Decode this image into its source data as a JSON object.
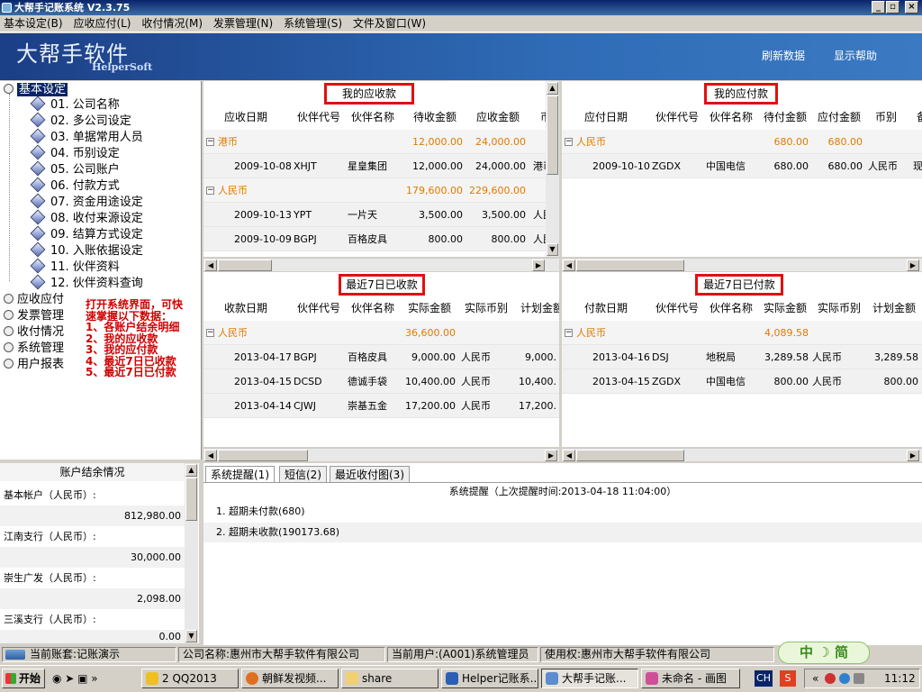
{
  "window": {
    "title": "大帮手记账系统 V2.3.75",
    "buttons": [
      "_",
      "▫",
      "×"
    ]
  },
  "menu": [
    "基本设定(B)",
    "应收应付(L)",
    "收付情况(M)",
    "发票管理(N)",
    "系统管理(S)",
    "文件及窗口(W)"
  ],
  "banner": {
    "logo_cn": "大帮手软件",
    "logo_en": "HelperSoft",
    "refresh": "刷新数据",
    "help": "显示帮助"
  },
  "tree": {
    "root": "基本设定",
    "items": [
      "01. 公司名称",
      "02. 多公司设定",
      "03. 单据常用人员",
      "04. 币别设定",
      "05. 公司账户",
      "06. 付款方式",
      "07. 资金用途设定",
      "08. 收付来源设定",
      "09. 结算方式设定",
      "10. 入账依据设定",
      "11. 伙伴资料",
      "12. 伙伴资料查询"
    ],
    "others": [
      "应收应付",
      "发票管理",
      "收付情况",
      "系统管理",
      "用户报表"
    ]
  },
  "note": "打开系统界面，可快\n速掌握以下数据：\n1、各账户结余明细\n2、我的应收款\n3、我的应付款\n4、最近7日已收款\n5、最近7日已付款",
  "receivable": {
    "title": "我的应收款",
    "headers": [
      "应收日期",
      "伙伴代号",
      "伙伴名称",
      "待收金额",
      "应收金额",
      "币"
    ],
    "groups": [
      {
        "name": "港币",
        "pending": "12,000.00",
        "amount": "24,000.00",
        "rows": [
          [
            "2009-10-08",
            "XHJT",
            "星皇集团",
            "12,000.00",
            "24,000.00",
            "港币"
          ]
        ]
      },
      {
        "name": "人民币",
        "pending": "179,600.00",
        "amount": "229,600.00",
        "rows": [
          [
            "2009-10-13",
            "YPT",
            "一片天",
            "3,500.00",
            "3,500.00",
            "人民币"
          ],
          [
            "2009-10-09",
            "BGPJ",
            "百格皮具",
            "800.00",
            "800.00",
            "人民币"
          ]
        ]
      }
    ]
  },
  "payable": {
    "title": "我的应付款",
    "headers": [
      "应付日期",
      "伙伴代号",
      "伙伴名称",
      "待付金额",
      "应付金额",
      "币别",
      "备"
    ],
    "groups": [
      {
        "name": "人民币",
        "pending": "680.00",
        "amount": "680.00",
        "rows": [
          [
            "2009-10-10",
            "ZGDX",
            "中国电信",
            "680.00",
            "680.00",
            "人民币",
            "现"
          ]
        ]
      }
    ]
  },
  "received7": {
    "title": "最近7日已收款",
    "headers": [
      "收款日期",
      "伙伴代号",
      "伙伴名称",
      "实际金额",
      "实际币别",
      "计划金额"
    ],
    "groups": [
      {
        "name": "人民币",
        "amount": "36,600.00",
        "rows": [
          [
            "2013-04-17",
            "BGPJ",
            "百格皮具",
            "9,000.00",
            "人民币",
            "9,000."
          ],
          [
            "2013-04-15",
            "DCSD",
            "德诚手袋",
            "10,400.00",
            "人民币",
            "10,400."
          ],
          [
            "2013-04-14",
            "CJWJ",
            "崇基五金",
            "17,200.00",
            "人民币",
            "17,200."
          ]
        ]
      }
    ]
  },
  "paid7": {
    "title": "最近7日已付款",
    "headers": [
      "付款日期",
      "伙伴代号",
      "伙伴名称",
      "实际金额",
      "实际币别",
      "计划金额"
    ],
    "groups": [
      {
        "name": "人民币",
        "amount": "4,089.58",
        "rows": [
          [
            "2013-04-16",
            "DSJ",
            "地税局",
            "3,289.58",
            "人民币",
            "3,289.58"
          ],
          [
            "2013-04-15",
            "ZGDX",
            "中国电信",
            "800.00",
            "人民币",
            "800.00"
          ]
        ]
      }
    ]
  },
  "accounts": {
    "title": "账户结余情况",
    "items": [
      {
        "name": "基本帐户（人民币）:",
        "balance": "812,980.00"
      },
      {
        "name": "江南支行（人民币）:",
        "balance": "30,000.00"
      },
      {
        "name": "崇生广发（人民币）:",
        "balance": "2,098.00"
      },
      {
        "name": "三溪支行（人民币）:",
        "balance": "0.00"
      }
    ]
  },
  "tabs": {
    "items": [
      "系统提醒(1)",
      "短信(2)",
      "最近收付图(3)"
    ],
    "header": "系统提醒（上次提醒时间:2013-04-18 11:04:00）",
    "reminders": [
      "1. 超期未付款(680)",
      "2. 超期未收款(190173.68)"
    ]
  },
  "status": [
    "当前账套:记账演示",
    "公司名称:惠州市大帮手软件有限公司",
    "当前用户:(A001)系统管理员",
    "使用权:惠州市大帮手软件有限公司"
  ],
  "ime": "中 ☽ 简",
  "taskbar": {
    "start": "开始",
    "items": [
      "2 QQ2013",
      "朝鲜发视频...",
      "share",
      "Helper记账系...",
      "大帮手记账...",
      "未命名 - 画图"
    ],
    "tray_icons": "CH",
    "clock": "11:12"
  }
}
